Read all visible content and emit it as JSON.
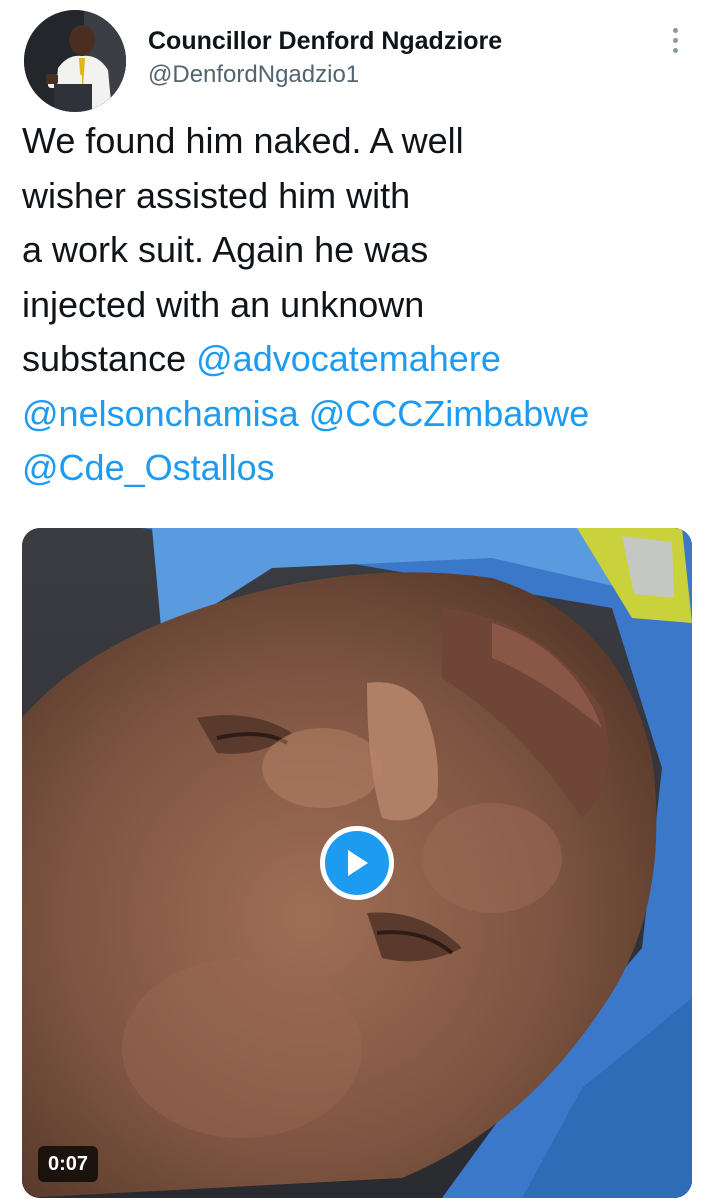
{
  "author": {
    "display_name": "Councillor Denford Ngadziore",
    "handle": "@DenfordNgadzio1",
    "avatar_icon": "profile-photo"
  },
  "tweet": {
    "lines": [
      {
        "text": "We found him naked.  A well",
        "mention": ""
      },
      {
        "text": "wisher  assisted him with",
        "mention": ""
      },
      {
        "text": "a work suit. Again he was",
        "mention": ""
      },
      {
        "text": "injected with an unknown",
        "mention": ""
      },
      {
        "text": "substance ",
        "mention": "@advocatemahere"
      }
    ],
    "mentions_line_1": [
      "@nelsonchamisa",
      "@CCCZimbabwe"
    ],
    "mentions_line_2": "@Cde_Ostallos"
  },
  "media": {
    "type": "video",
    "duration": "0:07",
    "play_icon": "play-icon"
  },
  "menu": {
    "icon": "more-vertical-icon"
  },
  "colors": {
    "mention": "#1d9bf0",
    "text": "#0f1419",
    "handle": "#536471",
    "play_button": "#1d9bf0"
  }
}
